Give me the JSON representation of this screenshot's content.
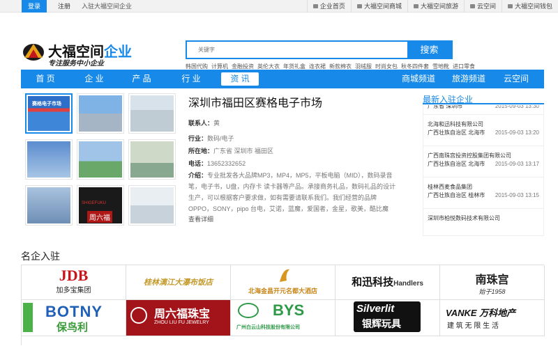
{
  "topbar": {
    "login": "登录",
    "register": "注册",
    "join": "入驻大福空间企业",
    "links": [
      {
        "label": "企业首页",
        "icon": "home-icon"
      },
      {
        "label": "大福空间商城",
        "icon": "cart-icon"
      },
      {
        "label": "大福空间旅游",
        "icon": "plane-icon"
      },
      {
        "label": "云空间",
        "icon": "cloud-icon"
      },
      {
        "label": "大福空间钱包",
        "icon": "wallet-icon"
      }
    ]
  },
  "logo": {
    "name_main": "大福空间",
    "name_accent": "企业",
    "slogan": "专注服务中小企业"
  },
  "search": {
    "placeholder": "关键字",
    "button": "搜索"
  },
  "hotwords": [
    "韩国代购",
    "计算机",
    "金融投资",
    "英伦大衣",
    "年货礼盒",
    "连衣裙",
    "新款棉衣",
    "羽绒服",
    "时尚女包",
    "秋冬四件套",
    "雪地靴",
    "进口零食"
  ],
  "nav": {
    "items": [
      "首 页",
      "企 业",
      "产 品",
      "行 业",
      "资 讯"
    ],
    "right_items": [
      "商城频道",
      "旅游频道",
      "云空间"
    ],
    "active": "资 讯"
  },
  "company": {
    "title": "深圳市福田区赛格电子市场",
    "contact_label": "联系人：",
    "contact": "黄",
    "industry_label": "行业：",
    "industry": "数码/电子",
    "location_label": "所在地：",
    "location": "广东省 深圳市 福田区",
    "phone_label": "电话：",
    "phone": "13652332652",
    "intro_label": "介绍：",
    "intro": "专业批发各大品牌MP3，MP4，MP5，平板电脑（MID），数码录音笔，电子书，U盘，内存卡 读卡器等产品。承接商务礼品，数码礼品的设计生产，可以根据客户要求做，如有需要请联系我们。我们经营的品牌OPPO，SONY，pipo 台电，艾诺，蓝魔，爱国者，金星，歌美，酷比魔",
    "more": "查看详细"
  },
  "gallery": {
    "captions": [
      "赛格电子市场",
      "SHIGEFUKU",
      "周六福"
    ],
    "colors": [
      "#2d6ec9",
      "#7fb3e6",
      "#c8d4dc",
      "#5b8ccf",
      "#9fc4e8",
      "#88a890",
      "#a9c3df",
      "#b01818",
      "#e9eef2"
    ]
  },
  "sidebar": {
    "title": "最新入驻企业",
    "items": [
      {
        "name": "",
        "region": "广东省 深圳市",
        "date": "2015-09-03 13:30"
      },
      {
        "name": "北海和迅科技有限公司",
        "region": "广西壮族自治区 北海市",
        "date": "2015-09-03 13:20"
      },
      {
        "name": "广西南珠宫投资控股集团有限公司",
        "region": "广西壮族自治区 北海市",
        "date": "2015-09-03 13:17"
      },
      {
        "name": "桂林西麦食品集团",
        "region": "广西壮族自治区 桂林市",
        "date": "2015-09-03 13:15"
      },
      {
        "name": "深圳市柏悦数码技术有限公司",
        "region": "",
        "date": ""
      }
    ]
  },
  "brands": {
    "title": "名企入驻",
    "items": [
      {
        "line1": "JDB",
        "line2": "加多宝集团"
      },
      {
        "line1": "桂林漓江大瀑布饭店",
        "line2": ""
      },
      {
        "line1": "北海金昌开元名都大酒店",
        "line2": ""
      },
      {
        "line1": "和迅科技",
        "line2": "Handlers"
      },
      {
        "line1": "南珠宫",
        "line2": "始于1958"
      },
      {
        "line1": "BOTNY",
        "line2": "保鸟利"
      },
      {
        "line1": "周六福珠宝",
        "line2": "ZHOU LIU FU JEWELRY"
      },
      {
        "line1": "BYS",
        "line2": "广州白云山科技股份有限公司"
      },
      {
        "line1": "Silverlit",
        "line2": "银辉玩具"
      },
      {
        "line1": "VANKE 万科地产",
        "line2": "建 筑 无 限 生 活"
      }
    ]
  }
}
